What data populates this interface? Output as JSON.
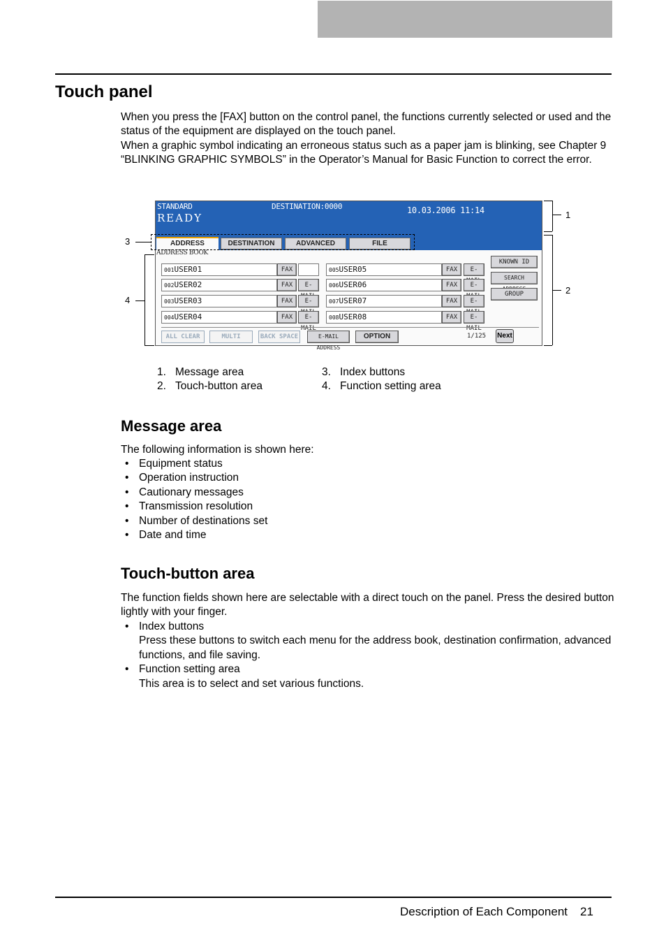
{
  "header": {
    "bar_color": "#b3b3b3"
  },
  "section": {
    "title": "Touch panel",
    "intro": [
      "When you press the [FAX] button on the control panel, the functions currently selected or used and the status of the equipment are displayed on the touch panel.",
      "When a graphic symbol indicating an erroneous status such as a paper jam is blinking, see Chapter 9 “BLINKING GRAPHIC SYMBOLS” in the Operator’s Manual for Basic Function to correct the error."
    ]
  },
  "panel": {
    "message_bg": "#2462b5",
    "mode": "STANDARD",
    "status": "READY",
    "destination": "DESTINATION:0000",
    "datetime": "10.03.2006 11:14",
    "tabs": [
      {
        "label": "ADDRESS",
        "active": true
      },
      {
        "label": "DESTINATION",
        "active": false
      },
      {
        "label": "ADVANCED",
        "active": false
      },
      {
        "label": "FILE",
        "active": false
      }
    ],
    "address_book_label": "ADDRESS BOOK",
    "entries": [
      {
        "num": "001",
        "name": "USER01",
        "fax": "FAX",
        "email": ""
      },
      {
        "num": "002",
        "name": "USER02",
        "fax": "FAX",
        "email": "E-MAIL"
      },
      {
        "num": "003",
        "name": "USER03",
        "fax": "FAX",
        "email": "E-MAIL"
      },
      {
        "num": "004",
        "name": "USER04",
        "fax": "FAX",
        "email": "E-MAIL"
      },
      {
        "num": "005",
        "name": "USER05",
        "fax": "FAX",
        "email": "E-MAIL"
      },
      {
        "num": "006",
        "name": "USER06",
        "fax": "FAX",
        "email": "E-MAIL"
      },
      {
        "num": "007",
        "name": "USER07",
        "fax": "FAX",
        "email": "E-MAIL"
      },
      {
        "num": "008",
        "name": "USER08",
        "fax": "FAX",
        "email": "E-MAIL"
      }
    ],
    "side_buttons": [
      "KNOWN ID",
      "SEARCH ADDRESS",
      "GROUP"
    ],
    "bottom_buttons": {
      "all_clear": "ALL CLEAR",
      "multi": "MULTI",
      "back_space": "BACK SPACE",
      "email_address": "E-MAIL ADDRESS",
      "option": "OPTION"
    },
    "page_indicator": "1/125",
    "next": "Next"
  },
  "callouts": {
    "c1": "1",
    "c2": "2",
    "c3": "3",
    "c4": "4"
  },
  "legend": [
    {
      "num": "1.",
      "label": "Message area"
    },
    {
      "num": "2.",
      "label": "Touch-button area"
    },
    {
      "num": "3.",
      "label": "Index buttons"
    },
    {
      "num": "4.",
      "label": "Function setting area"
    }
  ],
  "message_area": {
    "title": "Message area",
    "intro": "The following information is shown here:",
    "items": [
      "Equipment status",
      "Operation instruction",
      "Cautionary messages",
      "Transmission resolution",
      "Number of destinations set",
      "Date and time"
    ]
  },
  "touch_button_area": {
    "title": "Touch-button area",
    "intro": "The function fields shown here are selectable with a direct touch on the panel. Press the desired button lightly with your finger.",
    "items": [
      {
        "title": "Index buttons",
        "desc": "Press these buttons to switch each menu for the address book, destination confirmation, advanced functions, and file saving."
      },
      {
        "title": "Function setting area",
        "desc": "This area is to select and set various functions."
      }
    ]
  },
  "footer": {
    "section": "Description of Each Component",
    "page": "21"
  }
}
